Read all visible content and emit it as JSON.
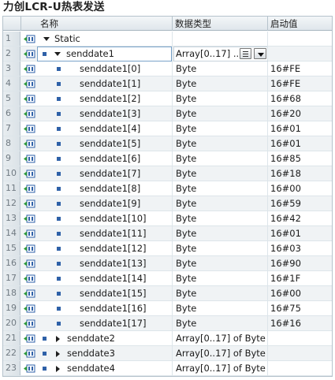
{
  "window": {
    "title": "力创LCR-U热表发送"
  },
  "headers": {
    "name": "名称",
    "datatype": "数据类型",
    "start_value": "启动值"
  },
  "rows": [
    {
      "num": "1",
      "name": "Static",
      "type": "",
      "start": ""
    },
    {
      "num": "2",
      "name": "senddate1",
      "type": "Array[0..17] ...",
      "start": ""
    },
    {
      "num": "3",
      "name": "senddate1[0]",
      "type": "Byte",
      "start": "16#FE"
    },
    {
      "num": "4",
      "name": "senddate1[1]",
      "type": "Byte",
      "start": "16#FE"
    },
    {
      "num": "5",
      "name": "senddate1[2]",
      "type": "Byte",
      "start": "16#68"
    },
    {
      "num": "6",
      "name": "senddate1[3]",
      "type": "Byte",
      "start": "16#20"
    },
    {
      "num": "7",
      "name": "senddate1[4]",
      "type": "Byte",
      "start": "16#01"
    },
    {
      "num": "8",
      "name": "senddate1[5]",
      "type": "Byte",
      "start": "16#01"
    },
    {
      "num": "9",
      "name": "senddate1[6]",
      "type": "Byte",
      "start": "16#85"
    },
    {
      "num": "10",
      "name": "senddate1[7]",
      "type": "Byte",
      "start": "16#18"
    },
    {
      "num": "11",
      "name": "senddate1[8]",
      "type": "Byte",
      "start": "16#00"
    },
    {
      "num": "12",
      "name": "senddate1[9]",
      "type": "Byte",
      "start": "16#59"
    },
    {
      "num": "13",
      "name": "senddate1[10]",
      "type": "Byte",
      "start": "16#42"
    },
    {
      "num": "14",
      "name": "senddate1[11]",
      "type": "Byte",
      "start": "16#01"
    },
    {
      "num": "15",
      "name": "senddate1[12]",
      "type": "Byte",
      "start": "16#03"
    },
    {
      "num": "16",
      "name": "senddate1[13]",
      "type": "Byte",
      "start": "16#90"
    },
    {
      "num": "17",
      "name": "senddate1[14]",
      "type": "Byte",
      "start": "16#1F"
    },
    {
      "num": "18",
      "name": "senddate1[15]",
      "type": "Byte",
      "start": "16#00"
    },
    {
      "num": "19",
      "name": "senddate1[16]",
      "type": "Byte",
      "start": "16#75"
    },
    {
      "num": "20",
      "name": "senddate1[17]",
      "type": "Byte",
      "start": "16#16"
    },
    {
      "num": "21",
      "name": "senddate2",
      "type": "Array[0..17] of Byte",
      "start": ""
    },
    {
      "num": "22",
      "name": "senddate3",
      "type": "Array[0..17] of Byte",
      "start": ""
    },
    {
      "num": "23",
      "name": "senddate4",
      "type": "Array[0..17] of Byte",
      "start": ""
    }
  ],
  "colors": {
    "icon_blue": "#2f61a8",
    "icon_green": "#2e9a3a",
    "row_alt": "#f0f3f5",
    "edit_border": "#7aa3c9"
  }
}
